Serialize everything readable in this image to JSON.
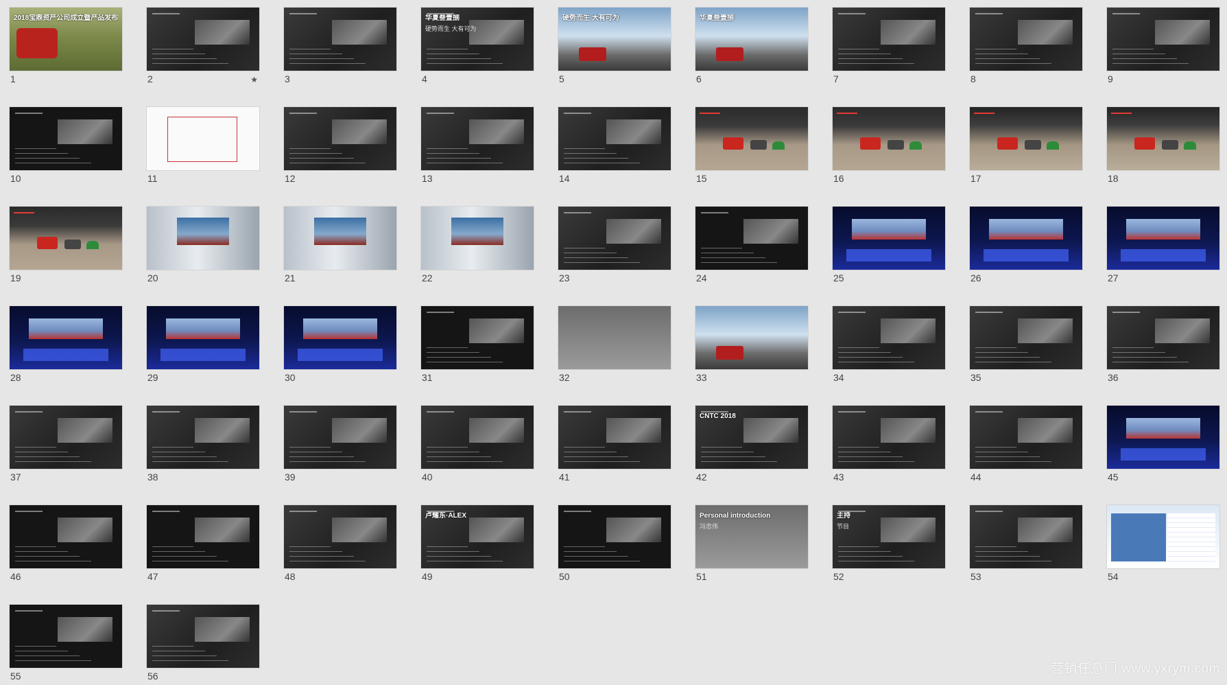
{
  "slides": [
    {
      "n": "1",
      "bg": "bg-grass",
      "title": "2018宝鼎资产公司成立暨产品发布会"
    },
    {
      "n": "2",
      "bg": "bg-dark",
      "star": "★"
    },
    {
      "n": "3",
      "bg": "bg-dark"
    },
    {
      "n": "4",
      "bg": "bg-dark",
      "title": "华夏叁壹捌",
      "sub": "硬势而生 大有可为"
    },
    {
      "n": "5",
      "bg": "bg-mountain",
      "title": "硬势而生 大有可为"
    },
    {
      "n": "6",
      "bg": "bg-mountain",
      "title": "华夏叁壹捌"
    },
    {
      "n": "7",
      "bg": "bg-dark"
    },
    {
      "n": "8",
      "bg": "bg-dark"
    },
    {
      "n": "9",
      "bg": "bg-dark"
    },
    {
      "n": "10",
      "bg": "bg-black"
    },
    {
      "n": "11",
      "bg": "bg-white"
    },
    {
      "n": "12",
      "bg": "bg-dark"
    },
    {
      "n": "13",
      "bg": "bg-dark"
    },
    {
      "n": "14",
      "bg": "bg-dark"
    },
    {
      "n": "15",
      "bg": "bg-desert"
    },
    {
      "n": "16",
      "bg": "bg-desert"
    },
    {
      "n": "17",
      "bg": "bg-desert2"
    },
    {
      "n": "18",
      "bg": "bg-desert2"
    },
    {
      "n": "19",
      "bg": "bg-desert"
    },
    {
      "n": "20",
      "bg": "bg-hall"
    },
    {
      "n": "21",
      "bg": "bg-hall"
    },
    {
      "n": "22",
      "bg": "bg-hall"
    },
    {
      "n": "23",
      "bg": "bg-dark"
    },
    {
      "n": "24",
      "bg": "bg-black"
    },
    {
      "n": "25",
      "bg": "bg-stage"
    },
    {
      "n": "26",
      "bg": "bg-stage"
    },
    {
      "n": "27",
      "bg": "bg-stage"
    },
    {
      "n": "28",
      "bg": "bg-stage"
    },
    {
      "n": "29",
      "bg": "bg-stage"
    },
    {
      "n": "30",
      "bg": "bg-stage"
    },
    {
      "n": "31",
      "bg": "bg-black"
    },
    {
      "n": "32",
      "bg": "bg-gray"
    },
    {
      "n": "33",
      "bg": "bg-mountain"
    },
    {
      "n": "34",
      "bg": "bg-dark"
    },
    {
      "n": "35",
      "bg": "bg-dark"
    },
    {
      "n": "36",
      "bg": "bg-dark"
    },
    {
      "n": "37",
      "bg": "bg-dark"
    },
    {
      "n": "38",
      "bg": "bg-dark"
    },
    {
      "n": "39",
      "bg": "bg-dark"
    },
    {
      "n": "40",
      "bg": "bg-dark"
    },
    {
      "n": "41",
      "bg": "bg-dark"
    },
    {
      "n": "42",
      "bg": "bg-dark",
      "title": "CNTC 2018"
    },
    {
      "n": "43",
      "bg": "bg-dark"
    },
    {
      "n": "44",
      "bg": "bg-dark"
    },
    {
      "n": "45",
      "bg": "bg-stage"
    },
    {
      "n": "46",
      "bg": "bg-black"
    },
    {
      "n": "47",
      "bg": "bg-black"
    },
    {
      "n": "48",
      "bg": "bg-dark"
    },
    {
      "n": "49",
      "bg": "bg-dark",
      "title": "卢耀东·ALEX"
    },
    {
      "n": "50",
      "bg": "bg-black"
    },
    {
      "n": "51",
      "bg": "bg-gray",
      "title": "Personal introduction",
      "sub": "冯忠伟"
    },
    {
      "n": "52",
      "bg": "bg-dark",
      "title": "主持",
      "sub": "节目"
    },
    {
      "n": "53",
      "bg": "bg-dark"
    },
    {
      "n": "54",
      "bg": "bg-blue-panel"
    },
    {
      "n": "55",
      "bg": "bg-black"
    },
    {
      "n": "56",
      "bg": "bg-dark"
    }
  ],
  "watermark": "营销任意门 www.yxrym.com"
}
